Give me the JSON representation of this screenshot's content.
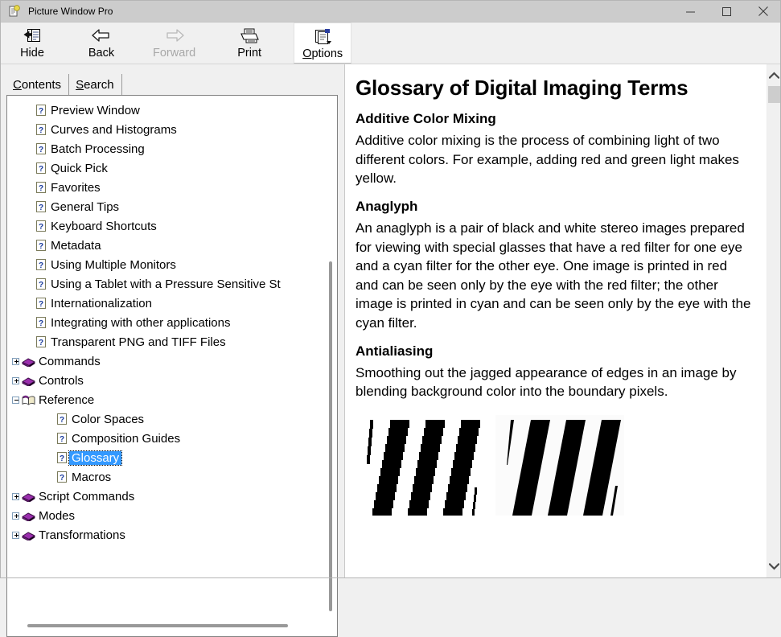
{
  "window": {
    "title": "Picture Window Pro",
    "app_icon": "help-document-icon",
    "controls": {
      "minimize": "minimize-icon",
      "maximize": "maximize-icon",
      "close": "close-icon"
    }
  },
  "toolbar": {
    "buttons": [
      {
        "label": "Hide",
        "accel": "H",
        "icon": "hide-pane-icon",
        "state": "enabled"
      },
      {
        "label": "Back",
        "accel": "B",
        "icon": "back-arrow-icon",
        "state": "enabled"
      },
      {
        "label": "Forward",
        "accel": "F",
        "icon": "forward-arrow-icon",
        "state": "disabled"
      },
      {
        "label": "Print",
        "accel": "P",
        "icon": "printer-icon",
        "state": "enabled"
      },
      {
        "label": "Options",
        "accel": "O",
        "icon": "options-icon",
        "state": "hovered"
      }
    ]
  },
  "tabs": [
    {
      "label": "Contents",
      "accel": "C",
      "active": true
    },
    {
      "label": "Search",
      "accel": "S",
      "active": false
    }
  ],
  "tree": {
    "items": [
      {
        "label": "Preview Window",
        "icon": "help-page-icon",
        "level": 1,
        "expander": "none"
      },
      {
        "label": "Curves and Histograms",
        "icon": "help-page-icon",
        "level": 1,
        "expander": "none"
      },
      {
        "label": "Batch Processing",
        "icon": "help-page-icon",
        "level": 1,
        "expander": "none"
      },
      {
        "label": "Quick Pick",
        "icon": "help-page-icon",
        "level": 1,
        "expander": "none"
      },
      {
        "label": "Favorites",
        "icon": "help-page-icon",
        "level": 1,
        "expander": "none"
      },
      {
        "label": "General Tips",
        "icon": "help-page-icon",
        "level": 1,
        "expander": "none"
      },
      {
        "label": "Keyboard Shortcuts",
        "icon": "help-page-icon",
        "level": 1,
        "expander": "none"
      },
      {
        "label": "Metadata",
        "icon": "help-page-icon",
        "level": 1,
        "expander": "none"
      },
      {
        "label": "Using Multiple Monitors",
        "icon": "help-page-icon",
        "level": 1,
        "expander": "none"
      },
      {
        "label": "Using a Tablet with a Pressure Sensitive St",
        "icon": "help-page-icon",
        "level": 1,
        "expander": "none"
      },
      {
        "label": "Internationalization",
        "icon": "help-page-icon",
        "level": 1,
        "expander": "none"
      },
      {
        "label": "Integrating with other applications",
        "icon": "help-page-icon",
        "level": 1,
        "expander": "none"
      },
      {
        "label": "Transparent PNG and TIFF Files",
        "icon": "help-page-icon",
        "level": 1,
        "expander": "none"
      },
      {
        "label": "Commands",
        "icon": "closed-book-icon",
        "level": 0,
        "expander": "plus"
      },
      {
        "label": "Controls",
        "icon": "closed-book-icon",
        "level": 0,
        "expander": "plus"
      },
      {
        "label": "Reference",
        "icon": "open-book-icon",
        "level": 0,
        "expander": "minus"
      },
      {
        "label": "Color Spaces",
        "icon": "help-page-icon",
        "level": 2,
        "expander": "none"
      },
      {
        "label": "Composition Guides",
        "icon": "help-page-icon",
        "level": 2,
        "expander": "none"
      },
      {
        "label": "Glossary",
        "icon": "help-page-icon",
        "level": 2,
        "expander": "none",
        "selected": true
      },
      {
        "label": "Macros",
        "icon": "help-page-icon",
        "level": 2,
        "expander": "none"
      },
      {
        "label": "Script Commands",
        "icon": "closed-book-icon",
        "level": 0,
        "expander": "plus"
      },
      {
        "label": "Modes",
        "icon": "closed-book-icon",
        "level": 0,
        "expander": "plus"
      },
      {
        "label": "Transformations",
        "icon": "closed-book-icon",
        "level": 0,
        "expander": "plus"
      }
    ]
  },
  "document": {
    "title": "Glossary of Digital Imaging Terms",
    "entries": [
      {
        "term": "Additive Color Mixing",
        "definition": "Additive color mixing is the process of combining light of two different colors. For example, adding red and green light makes yellow."
      },
      {
        "term": "Anaglyph",
        "definition": "An anaglyph is a pair of black and white stereo images prepared for viewing with special glasses that have a red filter for one eye and a cyan filter for the other eye. One image is printed in red and can be seen only by the eye with the red filter; the other image is printed in cyan and can be seen only by the eye with the cyan filter."
      },
      {
        "term": "Antialiasing",
        "definition": "Smoothing out the jagged appearance of edges in an image by blending background color into the boundary pixels."
      }
    ],
    "figure": {
      "name": "antialiasing-comparison-figure",
      "left_image_name": "aliased-stripes-image",
      "right_image_name": "antialiased-stripes-image"
    }
  },
  "scrollbars": {
    "document_up_arrow": "scroll-up-arrow-icon",
    "document_down_arrow": "scroll-down-arrow-icon"
  },
  "colors": {
    "selection": "#3399ff",
    "titlebar": "#cccccc",
    "chrome": "#f0f0f0",
    "book_icon": "#9b2fae",
    "question_mark": "#1a3c9c"
  }
}
